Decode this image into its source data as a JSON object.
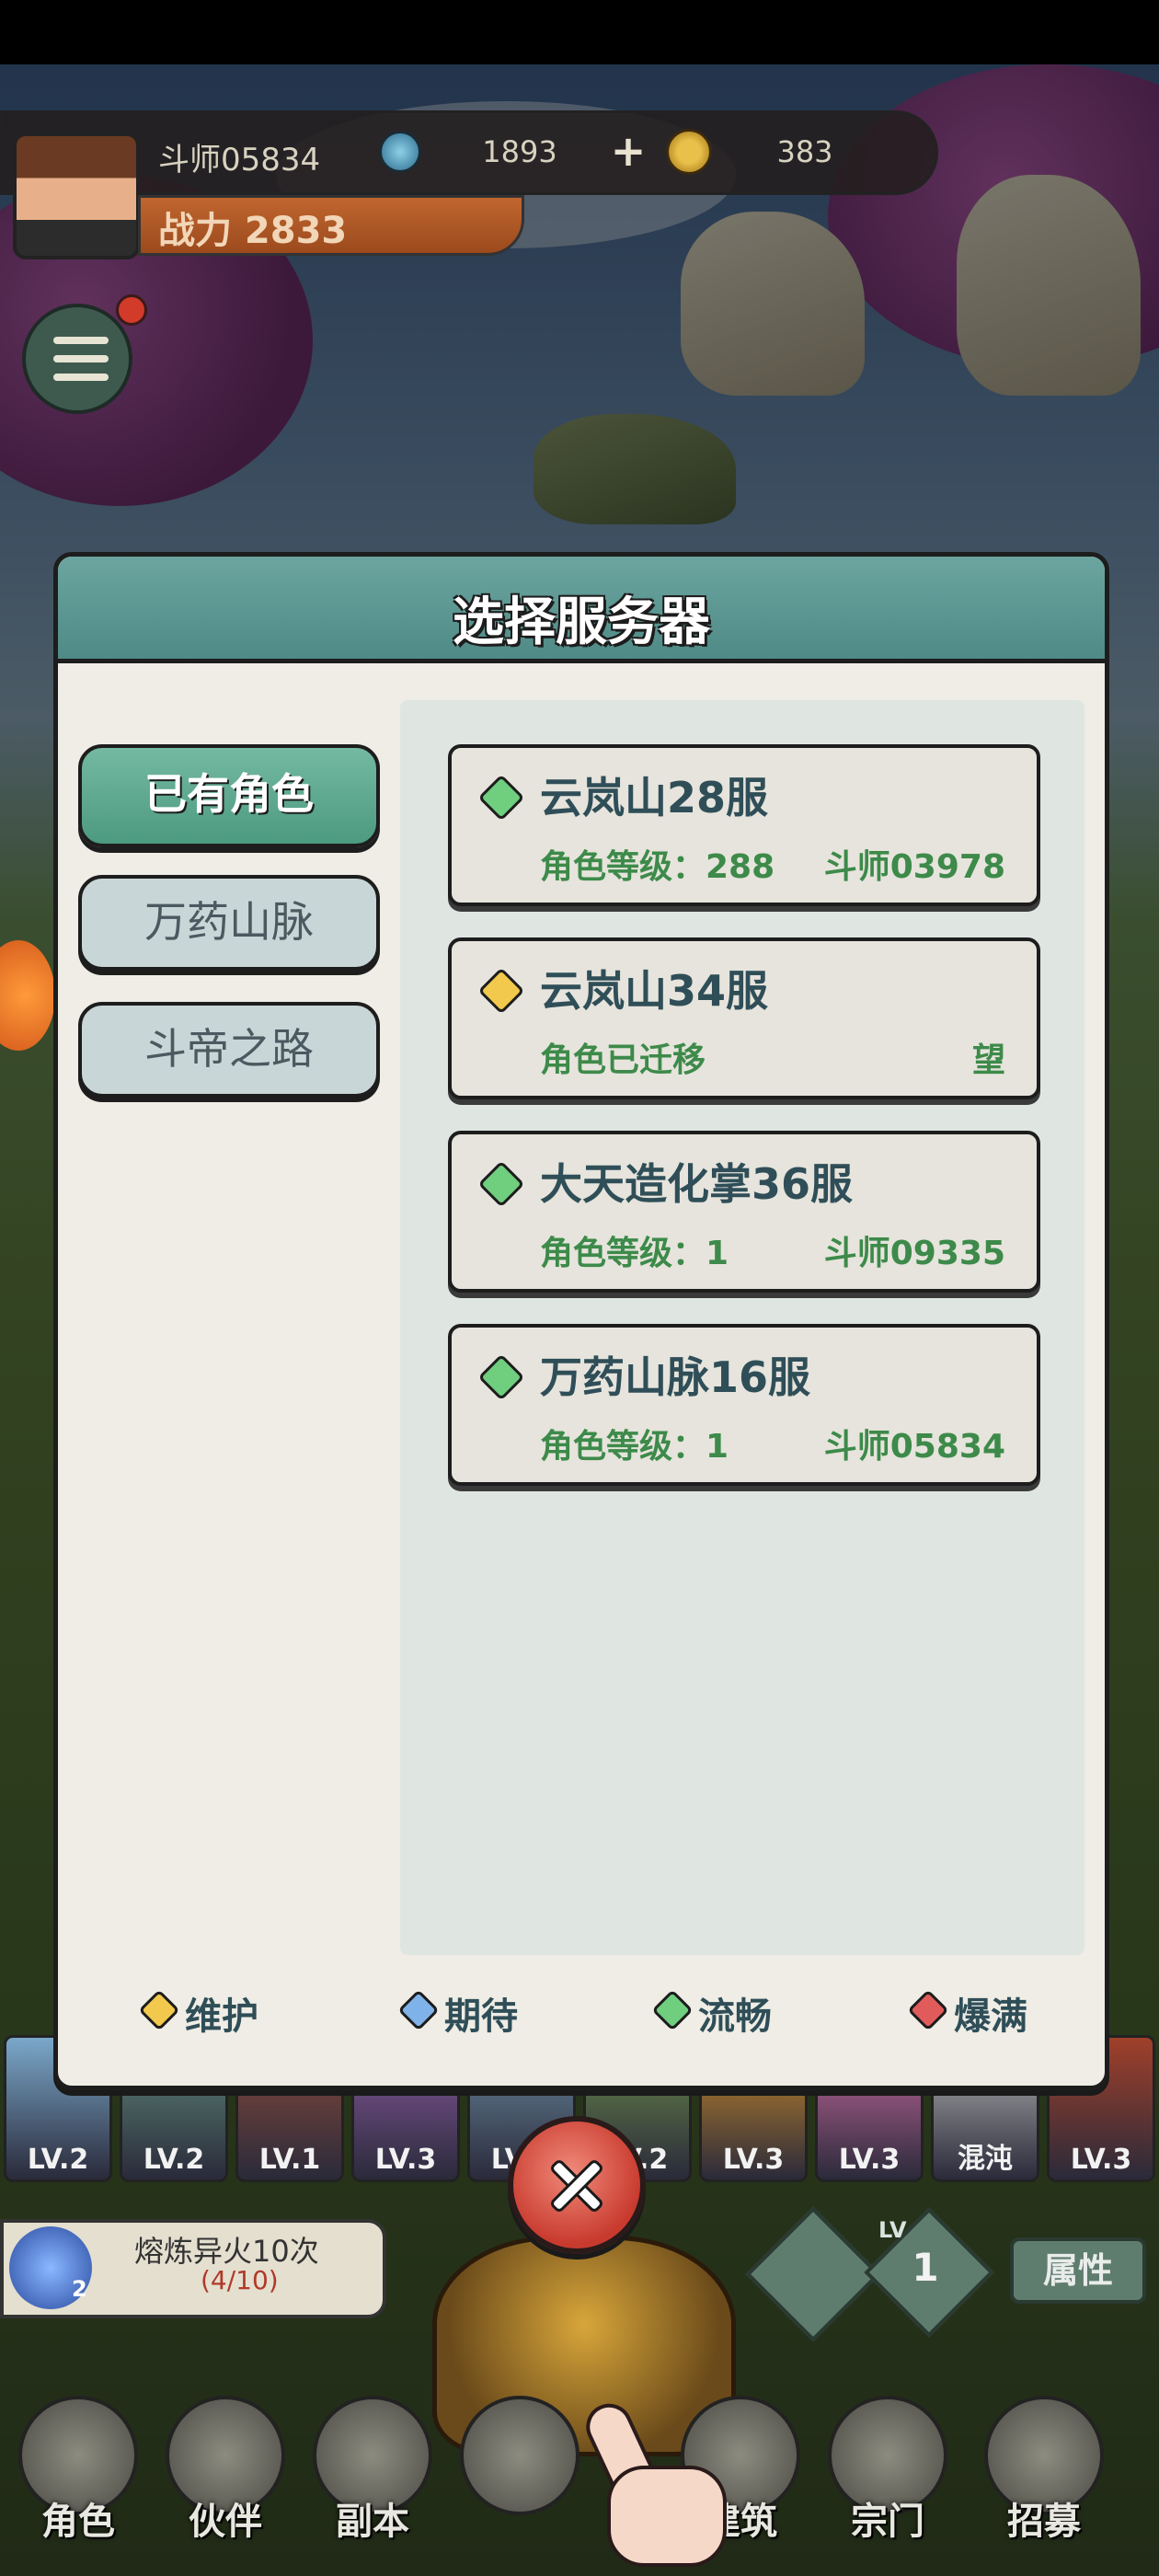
{
  "player": {
    "name": "斗师05834",
    "power_label": "战力 2833",
    "currency1": "1893",
    "currency2": "383",
    "add": "+"
  },
  "heroes": [
    {
      "lv": "LV.2"
    },
    {
      "lv": "LV.2"
    },
    {
      "lv": "LV.1"
    },
    {
      "lv": "LV.3"
    },
    {
      "lv": "LV.2"
    },
    {
      "lv": "LV.2"
    },
    {
      "lv": "LV.3"
    },
    {
      "lv": "LV.3"
    },
    {
      "lv": "混沌"
    },
    {
      "lv": "LV.3"
    }
  ],
  "task": {
    "title": "熔炼异火10次",
    "progress": "(4/10)",
    "count": "2"
  },
  "level": {
    "tag": "LV",
    "value": "1"
  },
  "attr_button": "属性",
  "nav": [
    {
      "label": "角色"
    },
    {
      "label": "伙伴"
    },
    {
      "label": "副本"
    },
    {
      "label": ""
    },
    {
      "label": "建筑"
    },
    {
      "label": "宗门"
    },
    {
      "label": "招募"
    }
  ],
  "dialog": {
    "title": "选择服务器",
    "tabs": [
      {
        "label": "已有角色",
        "active": true
      },
      {
        "label": "万药山脉",
        "active": false
      },
      {
        "label": "斗帝之路",
        "active": false
      }
    ],
    "servers": [
      {
        "name": "云岚山28服",
        "status": "green",
        "info_left": "角色等级：288",
        "info_right": "斗师03978"
      },
      {
        "name": "云岚山34服",
        "status": "yellow",
        "info_left": "角色已迁移",
        "info_right": "望"
      },
      {
        "name": "大天造化掌36服",
        "status": "green",
        "info_left": "角色等级：1",
        "info_right": "斗师09335"
      },
      {
        "name": "万药山脉16服",
        "status": "green",
        "info_left": "角色等级：1",
        "info_right": "斗师05834"
      }
    ],
    "legend": [
      {
        "label": "维护",
        "color": "#f2c94c"
      },
      {
        "label": "期待",
        "color": "#7fb2e8"
      },
      {
        "label": "流畅",
        "color": "#6fcf7f"
      },
      {
        "label": "爆满",
        "color": "#e25b5b"
      }
    ]
  },
  "colors": {
    "green": "#6fcf7f",
    "yellow": "#f2c94c",
    "accent": "#5f9c95"
  }
}
